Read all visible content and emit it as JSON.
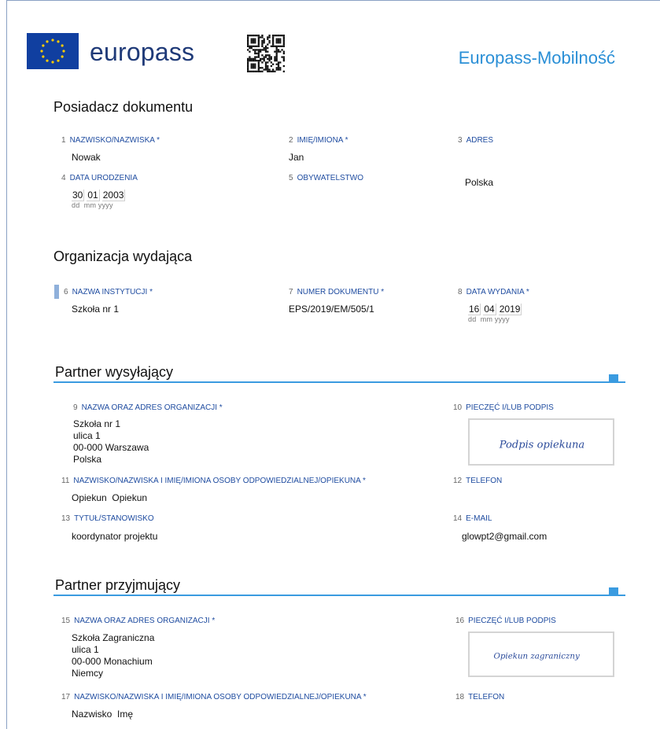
{
  "header": {
    "brand": "europass",
    "title": "Europass-Mobilność"
  },
  "holder": {
    "heading": "Posiadacz dokumentu",
    "fields": {
      "surname": {
        "num": "1",
        "label": "NAZWISKO/NAZWISKA *",
        "value": "Nowak"
      },
      "firstname": {
        "num": "2",
        "label": "IMIĘ/IMIONA *",
        "value": "Jan"
      },
      "address": {
        "num": "3",
        "label": "ADRES",
        "value": ""
      },
      "birthdate": {
        "num": "4",
        "label": "DATA URODZENIA",
        "dd": "30",
        "mm": "01",
        "yyyy": "2003",
        "sub": "dd  mm yyyy"
      },
      "citizenship": {
        "num": "5",
        "label": "OBYWATELSTWO",
        "value": "Polska"
      }
    }
  },
  "issuer": {
    "heading": "Organizacja wydająca",
    "fields": {
      "institution": {
        "num": "6",
        "label": "NAZWA INSTYTUCJI *",
        "value": "Szkoła nr 1"
      },
      "docnumber": {
        "num": "7",
        "label": "NUMER DOKUMENTU *",
        "value": "EPS/2019/EM/505/1"
      },
      "issuedate": {
        "num": "8",
        "label": "DATA WYDANIA *",
        "dd": "16",
        "mm": "04",
        "yyyy": "2019",
        "sub": "dd  mm yyyy"
      }
    }
  },
  "sending": {
    "heading": "Partner wysyłający",
    "org": {
      "num": "9",
      "label": "NAZWA ORAZ ADRES ORGANIZACJI *",
      "lines": [
        "Szkoła nr 1",
        "ulica 1",
        "00-000 Warszawa",
        "Polska"
      ]
    },
    "stamp": {
      "num": "10",
      "label": "PIECZĘĆ I/LUB PODPIS",
      "signature": "Podpis opiekuna"
    },
    "mentor": {
      "num": "11",
      "label": "NAZWISKO/NAZWISKA I IMIĘ/IMIONA OSOBY ODPOWIEDZIALNEJ/OPIEKUNA *",
      "value": "Opiekun  Opiekun"
    },
    "phone": {
      "num": "12",
      "label": "TELEFON",
      "value": ""
    },
    "title": {
      "num": "13",
      "label": "TYTUŁ/STANOWISKO",
      "value": "koordynator projektu"
    },
    "email": {
      "num": "14",
      "label": "E-MAIL",
      "value": "glowpt2@gmail.com"
    }
  },
  "receiving": {
    "heading": "Partner przyjmujący",
    "org": {
      "num": "15",
      "label": "NAZWA ORAZ ADRES ORGANIZACJI *",
      "lines": [
        "Szkoła Zagraniczna",
        "ulica 1",
        "00-000 Monachium",
        "Niemcy"
      ]
    },
    "stamp": {
      "num": "16",
      "label": "PIECZĘĆ I/LUB PODPIS",
      "signature": "Opiekun zagraniczny"
    },
    "mentor": {
      "num": "17",
      "label": "NAZWISKO/NAZWISKA I IMIĘ/IMIONA OSOBY ODPOWIEDZIALNEJ/OPIEKUNA *",
      "value": "Nazwisko  Imę"
    },
    "phone": {
      "num": "18",
      "label": "TELEFON",
      "value": ""
    }
  },
  "colors": {
    "accent": "#3a9be0",
    "label": "#1f4ca0",
    "brand": "#1f3a78",
    "flag": "#103fa0",
    "star": "#ffcc00"
  },
  "icons": {
    "flag": "eu-flag-icon",
    "qr": "qr-code-icon"
  }
}
